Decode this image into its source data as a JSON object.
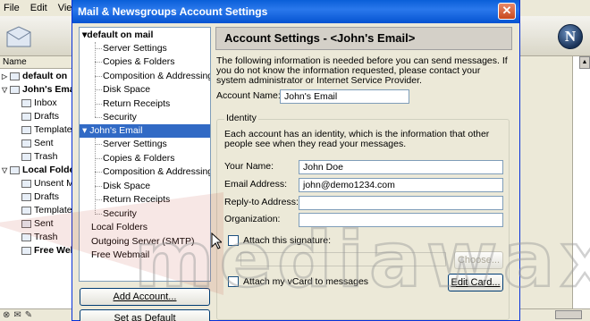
{
  "background_app": {
    "menu": [
      "File",
      "Edit",
      "View"
    ],
    "name_header": "Name",
    "folders": [
      {
        "label": "default on",
        "bold": true,
        "icon": "mail-account-icon",
        "twisty": "▷"
      },
      {
        "label": "John's Ema",
        "bold": true,
        "icon": "mail-account-icon",
        "twisty": "▽"
      },
      {
        "label": "Inbox",
        "bold": false,
        "icon": "inbox-icon",
        "twisty": ""
      },
      {
        "label": "Drafts",
        "bold": false,
        "icon": "drafts-icon",
        "twisty": ""
      },
      {
        "label": "Template",
        "bold": false,
        "icon": "templates-icon",
        "twisty": ""
      },
      {
        "label": "Sent",
        "bold": false,
        "icon": "sent-icon",
        "twisty": ""
      },
      {
        "label": "Trash",
        "bold": false,
        "icon": "trash-icon",
        "twisty": ""
      },
      {
        "label": "Local Folde",
        "bold": true,
        "icon": "local-folders-icon",
        "twisty": "▽"
      },
      {
        "label": "Unsent M",
        "bold": false,
        "icon": "unsent-icon",
        "twisty": ""
      },
      {
        "label": "Drafts",
        "bold": false,
        "icon": "drafts-icon",
        "twisty": ""
      },
      {
        "label": "Template",
        "bold": false,
        "icon": "templates-icon",
        "twisty": ""
      },
      {
        "label": "Sent",
        "bold": false,
        "icon": "sent-icon",
        "twisty": ""
      },
      {
        "label": "Trash",
        "bold": false,
        "icon": "trash-icon",
        "twisty": ""
      },
      {
        "label": "Free Webm",
        "bold": true,
        "icon": "webmail-icon",
        "twisty": ""
      }
    ],
    "logo_letter": "N"
  },
  "watermark": "mediawax",
  "dialog": {
    "title": "Mail & Newsgroups Account Settings",
    "tree": {
      "accounts": [
        {
          "label": "default on mail",
          "twisty": "▾",
          "children": [
            "Server Settings",
            "Copies & Folders",
            "Composition & Addressing",
            "Disk Space",
            "Return Receipts",
            "Security"
          ]
        },
        {
          "label": "John's Email",
          "twisty": "▾",
          "selected": true,
          "children": [
            "Server Settings",
            "Copies & Folders",
            "Composition & Addressing",
            "Disk Space",
            "Return Receipts",
            "Security"
          ]
        }
      ],
      "other": [
        "Local Folders",
        "Outgoing Server (SMTP)",
        "Free Webmail"
      ]
    },
    "buttons": {
      "add_account": "Add Account...",
      "set_default": "Set as Default"
    },
    "panel": {
      "header": "Account Settings - <John's Email>",
      "intro": "The following information is needed before you can send messages. If you do not know the information requested, please contact your system administrator or Internet Service Provider.",
      "account_name_label": "Account Name:",
      "account_name_value": "John's Email",
      "identity_legend": "Identity",
      "identity_intro": "Each account has an identity, which is the information that other people see when they read your messages.",
      "fields": [
        {
          "label": "Your Name:",
          "value": "John Doe"
        },
        {
          "label": "Email Address:",
          "value": "john@demo1234.com"
        },
        {
          "label": "Reply-to Address:",
          "value": ""
        },
        {
          "label": "Organization:",
          "value": ""
        }
      ],
      "attach_signature_label": "Attach this signature:",
      "attach_signature_checked": false,
      "signature_path": "",
      "choose_button": "Choose...",
      "attach_vcard_label": "Attach my vCard to messages",
      "attach_vcard_checked": false,
      "edit_card_button": "Edit Card..."
    }
  }
}
